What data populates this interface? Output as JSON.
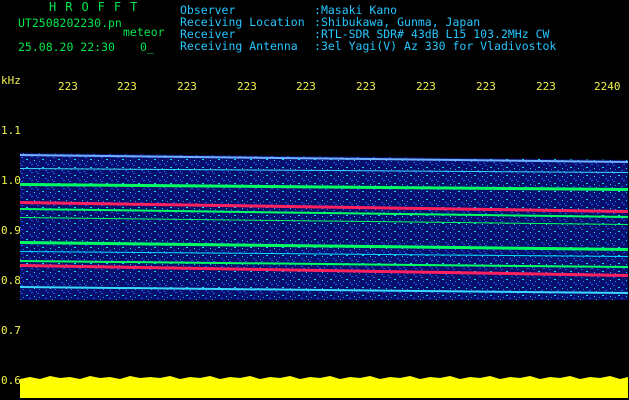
{
  "header": {
    "app_name": "HROFFT",
    "filename": "UT2508202230.pn",
    "detect_label": "meteor",
    "datetime": "25.08.20 22:30",
    "count": "0_"
  },
  "station": [
    {
      "key": "Observer",
      "sep": ":",
      "value": "Masaki Kano"
    },
    {
      "key": "Receiving Location",
      "sep": ":",
      "value": "Shibukawa, Gunma, Japan"
    },
    {
      "key": "Receiver",
      "sep": ":",
      "value": "RTL-SDR SDR# 43dB L15 103.2MHz CW"
    },
    {
      "key": "Receiving Antenna",
      "sep": ":",
      "value": "3el Yagi(V) Az 330 for Vladivostok"
    }
  ],
  "axes": {
    "y_unit": "kHz",
    "y_ticks": [
      "1.1",
      "1.0",
      "0.9",
      "0.8",
      "0.7",
      "0.6"
    ],
    "x_ticks": [
      "223",
      "223",
      "223",
      "223",
      "223",
      "223",
      "223",
      "223",
      "223",
      "2240"
    ]
  },
  "colors": {
    "background": "#000000",
    "noise_floor": "#000066",
    "signal_blue": "#1e50ff",
    "signal_cyan": "#00e0ff",
    "signal_green": "#00ff60",
    "signal_red": "#ff2060",
    "amplitude": "#ffff00",
    "label_text": "#26c6ff",
    "tick_text": "#f2f24a"
  }
}
